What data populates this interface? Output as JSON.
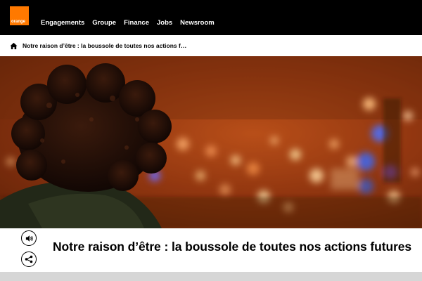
{
  "brand": {
    "logo_text": "orange",
    "accent": "#ff7900"
  },
  "nav": {
    "items": [
      {
        "label": "Engagements"
      },
      {
        "label": "Groupe"
      },
      {
        "label": "Finance"
      },
      {
        "label": "Jobs"
      },
      {
        "label": "Newsroom"
      }
    ]
  },
  "breadcrumb": {
    "icon": "home-icon",
    "text": "Notre raison d’être : la boussole de toutes nos actions f…"
  },
  "hero": {
    "image": "person-with-curly-hair-overlooking-city-lights-at-night"
  },
  "article": {
    "title": "Notre raison d’être : la boussole de toutes nos actions futures",
    "audio_icon": "speaker-icon",
    "share_icon": "share-icon"
  }
}
